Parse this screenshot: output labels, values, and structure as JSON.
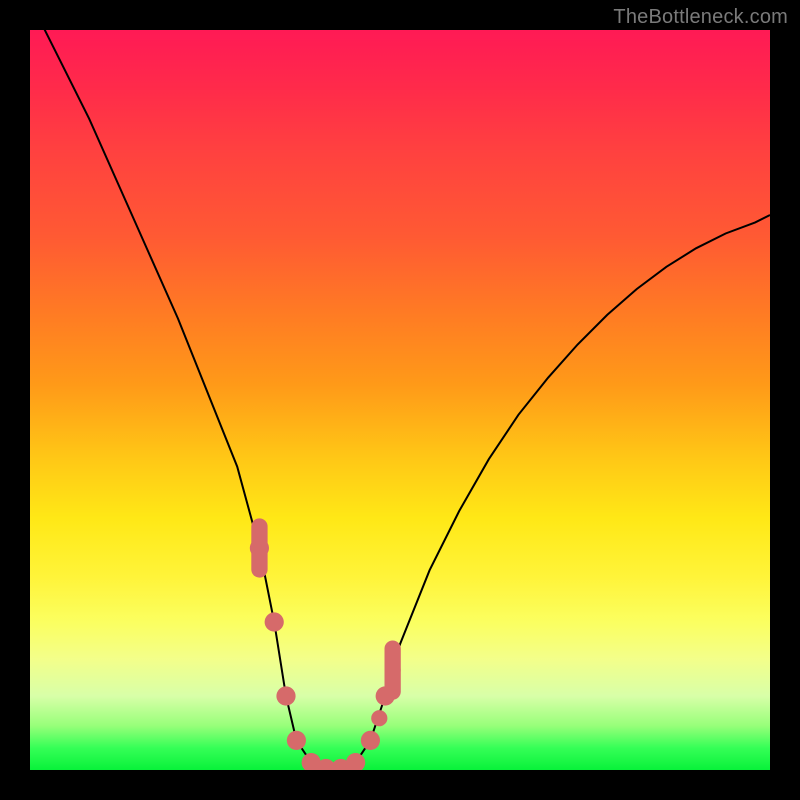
{
  "watermark": "TheBottleneck.com",
  "colors": {
    "frame": "#000000",
    "curve": "#000000",
    "marker": "#d66a6a"
  },
  "chart_data": {
    "type": "line",
    "title": "",
    "xlabel": "",
    "ylabel": "",
    "xlim": [
      0,
      100
    ],
    "ylim": [
      0,
      100
    ],
    "grid": false,
    "legend": false,
    "series": [
      {
        "name": "bottleneck-curve",
        "x": [
          0,
          4,
          8,
          12,
          16,
          20,
          24,
          28,
          31,
          33,
          34.6,
          36,
          38,
          40,
          42,
          44,
          46,
          48,
          50,
          54,
          58,
          62,
          66,
          70,
          74,
          78,
          82,
          86,
          90,
          94,
          98,
          100
        ],
        "y": [
          104,
          96,
          88,
          79,
          70,
          61,
          51,
          41,
          30,
          20,
          10,
          4,
          1,
          0.2,
          0.2,
          1,
          4,
          10,
          17,
          27,
          35,
          42,
          48,
          53,
          57.5,
          61.5,
          65,
          68,
          70.5,
          72.5,
          74,
          75
        ]
      }
    ],
    "markers": {
      "name": "highlight-points",
      "points": [
        {
          "x": 31.0,
          "y": 30,
          "r": 1.3
        },
        {
          "x": 33.0,
          "y": 20,
          "r": 1.3
        },
        {
          "x": 34.6,
          "y": 10,
          "r": 1.3
        },
        {
          "x": 36.0,
          "y": 4,
          "r": 1.3
        },
        {
          "x": 38.0,
          "y": 1,
          "r": 1.3
        },
        {
          "x": 40.0,
          "y": 0.2,
          "r": 1.3
        },
        {
          "x": 42.0,
          "y": 0.2,
          "r": 1.3
        },
        {
          "x": 44.0,
          "y": 1,
          "r": 1.3
        },
        {
          "x": 46.0,
          "y": 4,
          "r": 1.3
        },
        {
          "x": 47.2,
          "y": 7,
          "r": 1.1
        },
        {
          "x": 48.0,
          "y": 10,
          "r": 1.3
        },
        {
          "x": 49.0,
          "y": 13.5,
          "r": 1.1
        }
      ],
      "caps": [
        {
          "x": 31.0,
          "y": 30,
          "w": 2.2,
          "h": 8
        },
        {
          "x": 49.0,
          "y": 13.5,
          "w": 2.2,
          "h": 8
        }
      ]
    }
  }
}
